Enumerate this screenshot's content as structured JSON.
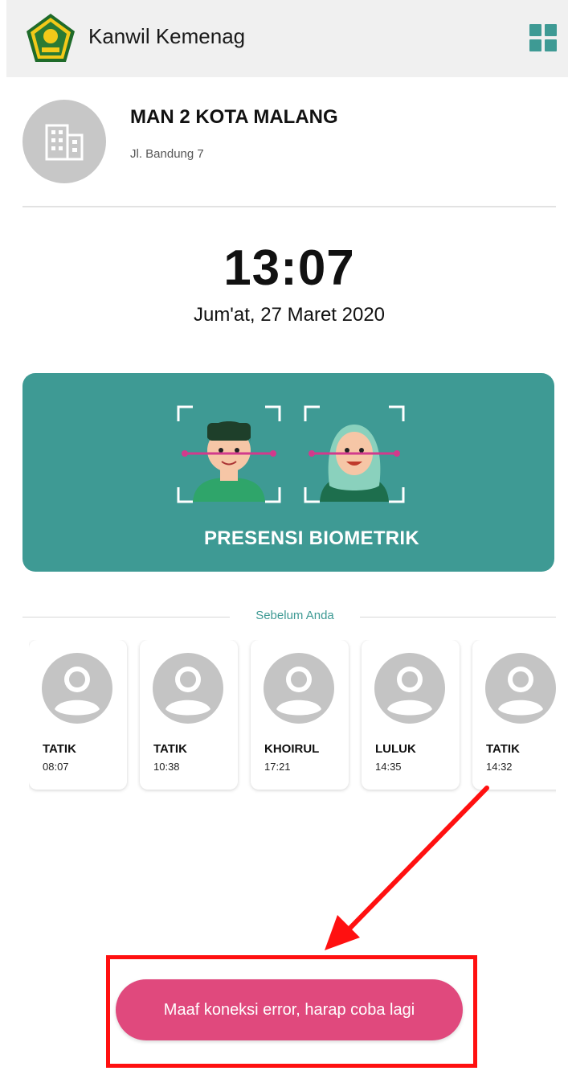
{
  "app": {
    "title": "Kanwil Kemenag",
    "logo_icon": "kemenag-emblem-icon",
    "menu_icon": "grid-menu-icon"
  },
  "school": {
    "name": "MAN 2 KOTA MALANG",
    "address": "Jl. Bandung 7",
    "icon": "building-icon"
  },
  "clock": {
    "time": "13:07",
    "date": "Jum'at, 27 Maret 2020"
  },
  "biometric": {
    "label": "PRESENSI BIOMETRIK",
    "icon": "face-scan-icon"
  },
  "recent": {
    "title": "Sebelum Anda",
    "people": [
      {
        "name": "TATIK",
        "time": "08:07"
      },
      {
        "name": "TATIK",
        "time": "10:38"
      },
      {
        "name": "KHOIRUL",
        "time": "17:21"
      },
      {
        "name": "LULUK",
        "time": "14:35"
      },
      {
        "name": "TATIK",
        "time": "14:32"
      }
    ]
  },
  "toast": {
    "message": "Maaf koneksi error, harap coba lagi"
  },
  "colors": {
    "accent": "#3e9a94",
    "toast": "#e0497d",
    "annotation": "#ff1010",
    "appbar": "#f0f0f0"
  }
}
